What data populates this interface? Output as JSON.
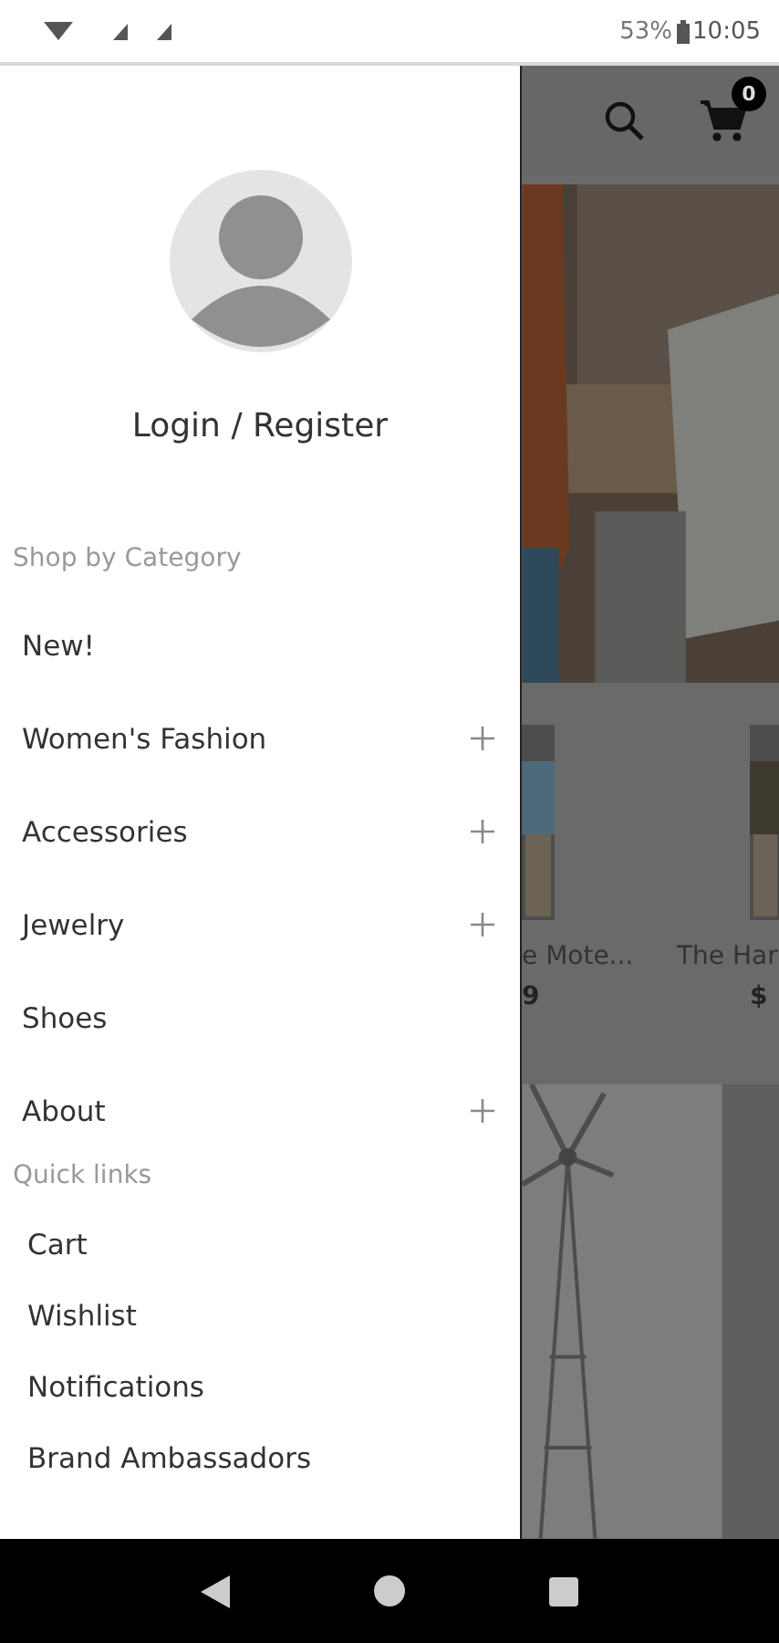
{
  "status_bar": {
    "battery": "53%",
    "time": "10:05"
  },
  "drawer": {
    "account_label": "Login / Register",
    "sections": [
      {
        "title": "Shop by Category",
        "kind": "category",
        "items": [
          {
            "label": "New!",
            "expandable": false
          },
          {
            "label": "Women's Fashion",
            "expandable": true
          },
          {
            "label": "Accessories",
            "expandable": true
          },
          {
            "label": "Jewelry",
            "expandable": true
          },
          {
            "label": "Shoes",
            "expandable": false
          },
          {
            "label": "About",
            "expandable": true
          }
        ]
      },
      {
        "title": "Quick links",
        "kind": "links",
        "items": [
          {
            "label": "Cart",
            "expandable": false
          },
          {
            "label": "Wishlist",
            "expandable": false
          },
          {
            "label": "Notifications",
            "expandable": false
          },
          {
            "label": "Brand Ambassadors",
            "expandable": false
          }
        ]
      }
    ]
  },
  "background": {
    "cart_count": "0",
    "products": [
      {
        "name": "e Mote...",
        "price": "9"
      },
      {
        "name": "The Har",
        "price": "$"
      }
    ]
  }
}
